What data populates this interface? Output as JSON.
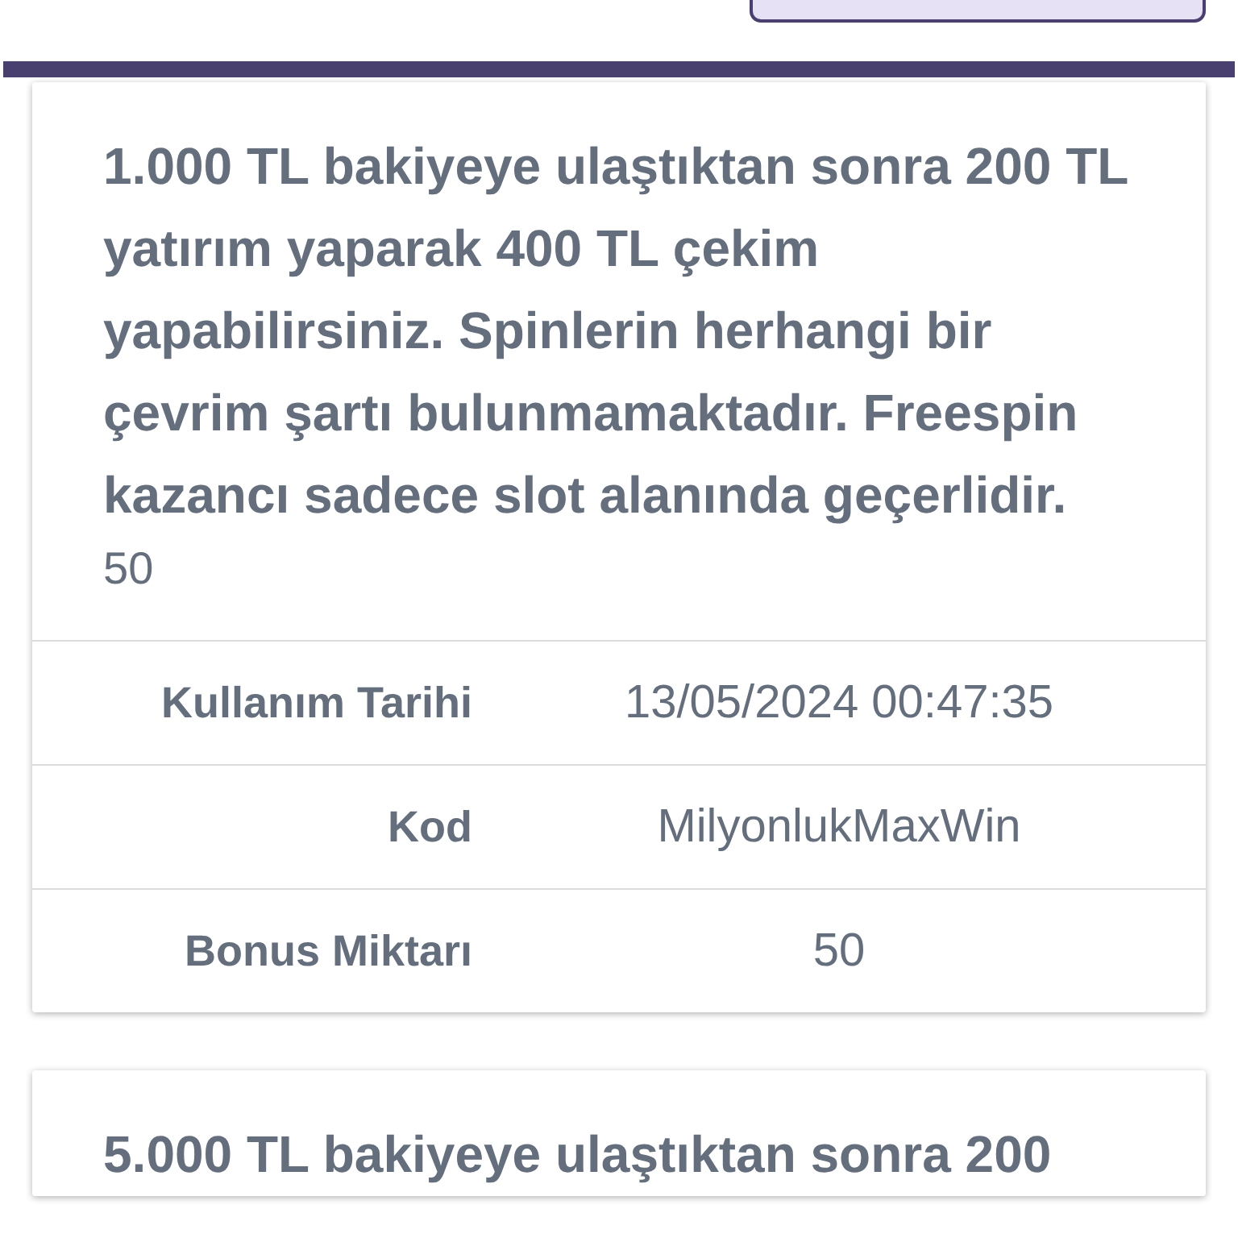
{
  "bonuses": [
    {
      "description": "1.000 TL bakiyeye ulaştıktan sonra 200 TL yatırım yaparak 400 TL çekim yapabilirsiniz. Spinlerin herhangi bir çevrim şartı bulunmamaktadır. Freespin kazancı sadece slot alanında geçerlidir.",
      "amount": "50",
      "details": [
        {
          "label": "Kullanım Tarihi",
          "value": "13/05/2024 00:47:35"
        },
        {
          "label": "Kod",
          "value": "MilyonlukMaxWin"
        },
        {
          "label": "Bonus Miktarı",
          "value": "50"
        }
      ]
    },
    {
      "description": "5.000 TL bakiyeye ulaştıktan sonra 200"
    }
  ]
}
